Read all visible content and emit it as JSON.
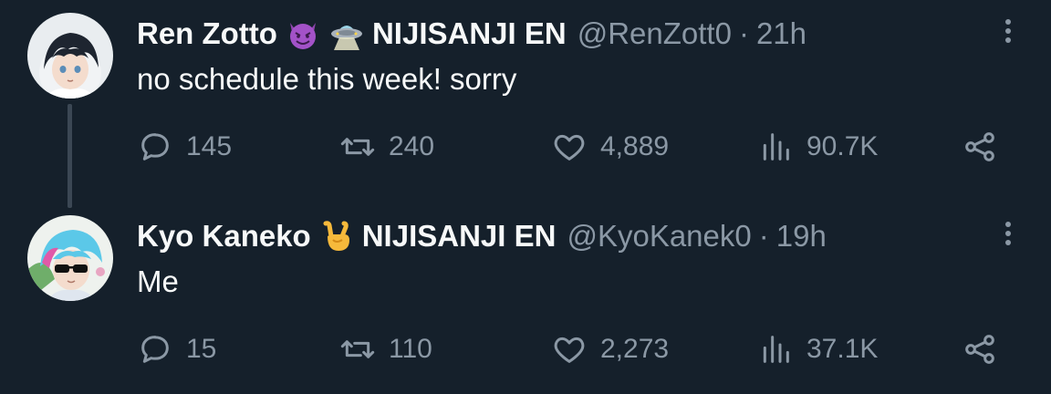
{
  "tweets": [
    {
      "name": "Ren Zotto",
      "emojis": [
        "smiling-imp-emoji",
        "ufo-emoji"
      ],
      "affiliation": "NIJISANJI EN",
      "handle": "@RenZott0",
      "separator": "·",
      "time": "21h",
      "text": "no schedule this week! sorry",
      "replies": "145",
      "retweets": "240",
      "likes": "4,889",
      "views": "90.7K"
    },
    {
      "name": "Kyo Kaneko",
      "emojis": [
        "sign-of-horns-emoji"
      ],
      "affiliation": "NIJISANJI EN",
      "handle": "@KyoKanek0",
      "separator": "·",
      "time": "19h",
      "text": "Me",
      "replies": "15",
      "retweets": "110",
      "likes": "2,273",
      "views": "37.1K"
    }
  ],
  "colors": {
    "background": "#15202b",
    "text_primary": "#f7f9f9",
    "text_secondary": "#8b98a5",
    "thread_line": "#3b4754"
  }
}
